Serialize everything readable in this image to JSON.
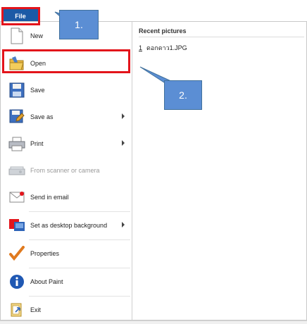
{
  "file_tab": {
    "label": "File"
  },
  "menu": {
    "items": [
      {
        "label": "New",
        "icon": "new-document-icon",
        "has_submenu": false,
        "disabled": false
      },
      {
        "label": "Open",
        "icon": "open-folder-icon",
        "has_submenu": false,
        "disabled": false
      },
      {
        "label": "Save",
        "icon": "save-disk-icon",
        "has_submenu": false,
        "disabled": false
      },
      {
        "label": "Save as",
        "icon": "save-as-icon",
        "has_submenu": true,
        "disabled": false
      },
      {
        "label": "Print",
        "icon": "printer-icon",
        "has_submenu": true,
        "disabled": false
      },
      {
        "label": "From scanner or camera",
        "icon": "scanner-icon",
        "has_submenu": false,
        "disabled": true
      },
      {
        "label": "Send in email",
        "icon": "email-icon",
        "has_submenu": false,
        "disabled": false
      },
      {
        "label": "Set as desktop background",
        "icon": "desktop-background-icon",
        "has_submenu": true,
        "disabled": false
      },
      {
        "label": "Properties",
        "icon": "checkmark-icon",
        "has_submenu": false,
        "disabled": false
      },
      {
        "label": "About Paint",
        "icon": "info-icon",
        "has_submenu": false,
        "disabled": false
      },
      {
        "label": "Exit",
        "icon": "exit-icon",
        "has_submenu": false,
        "disabled": false
      }
    ]
  },
  "recent": {
    "title": "Recent pictures",
    "items": [
      {
        "number": "1",
        "name": "ดอกดาว1.JPG"
      }
    ]
  },
  "callouts": {
    "one": "1.",
    "two": "2."
  },
  "colors": {
    "file_tab": "#1c5aa6",
    "highlight": "#e3141b",
    "callout": "#5b8ed4"
  }
}
